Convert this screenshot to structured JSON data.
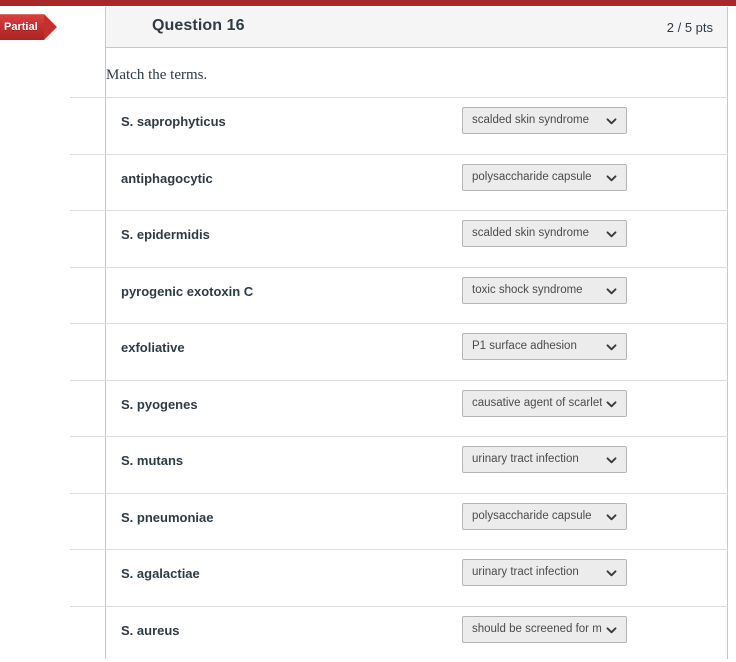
{
  "top_bar": {
    "color": "#a8282a"
  },
  "question": {
    "status_flag": "Partial",
    "title": "Question 16",
    "points": "2 / 5 pts",
    "prompt": "Match the terms."
  },
  "colors": {
    "accent_red": "#a8282a",
    "flag_red": "#c3302f",
    "text_dark": "#2d3b45",
    "select_bg": "#ececec",
    "select_border": "#b5b5b5",
    "divider": "#dcdcdc"
  },
  "icons": {
    "dropdown": "chevron-down-icon"
  },
  "matches": [
    {
      "term": "S. saprophyticus",
      "answer": "scalded skin syndrome"
    },
    {
      "term": "antiphagocytic",
      "answer": "polysaccharide capsule"
    },
    {
      "term": "S. epidermidis",
      "answer": "scalded skin syndrome"
    },
    {
      "term": "pyrogenic exotoxin C",
      "answer": "toxic shock syndrome"
    },
    {
      "term": "exfoliative",
      "answer": "P1 surface adhesion"
    },
    {
      "term": "S. pyogenes",
      "answer": "causative agent of scarlet fever"
    },
    {
      "term": "S. mutans",
      "answer": "urinary tract infection"
    },
    {
      "term": "S. pneumoniae",
      "answer": "polysaccharide capsule"
    },
    {
      "term": "S. agalactiae",
      "answer": "urinary tract infection"
    },
    {
      "term": "S. aureus",
      "answer": "should be screened for methicillin resistance"
    }
  ]
}
